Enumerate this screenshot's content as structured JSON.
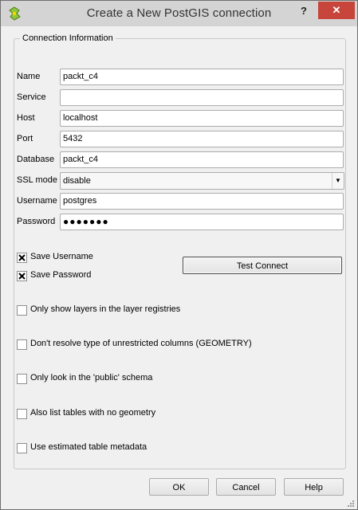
{
  "window": {
    "title": "Create a New PostGIS connection",
    "help_label": "?",
    "close_label": "✕"
  },
  "group": {
    "title": "Connection Information"
  },
  "fields": {
    "name": {
      "label": "Name",
      "value": "packt_c4"
    },
    "service": {
      "label": "Service",
      "value": ""
    },
    "host": {
      "label": "Host",
      "value": "localhost"
    },
    "port": {
      "label": "Port",
      "value": "5432"
    },
    "database": {
      "label": "Database",
      "value": "packt_c4"
    },
    "ssl_mode": {
      "label": "SSL mode",
      "value": "disable"
    },
    "username": {
      "label": "Username",
      "value": "postgres"
    },
    "password": {
      "label": "Password",
      "value": "●●●●●●●"
    }
  },
  "options": {
    "save_username": {
      "label": "Save Username",
      "checked": true
    },
    "save_password": {
      "label": "Save Password",
      "checked": true
    },
    "only_registries": {
      "label": "Only show layers in the layer registries",
      "checked": false
    },
    "dont_resolve": {
      "label": "Don't resolve type of unrestricted columns (GEOMETRY)",
      "checked": false
    },
    "public_schema": {
      "label": "Only look in the 'public' schema",
      "checked": false
    },
    "no_geometry": {
      "label": "Also list tables with no geometry",
      "checked": false
    },
    "estimated_metadata": {
      "label": "Use estimated table metadata",
      "checked": false
    }
  },
  "buttons": {
    "test_connect": "Test Connect",
    "ok": "OK",
    "cancel": "Cancel",
    "help": "Help"
  }
}
